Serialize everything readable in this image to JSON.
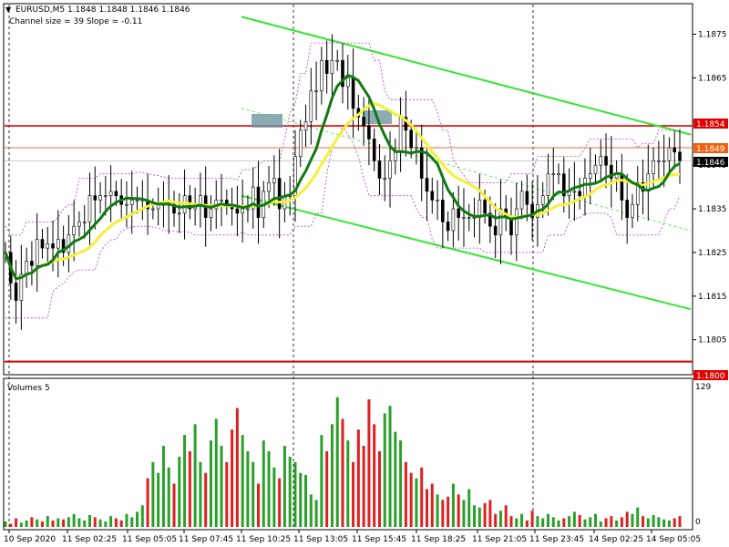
{
  "header": {
    "symbol_line": "EURUSD,M5  1.1848 1.1848 1.1846 1.1846",
    "channel_line": "Channel size = 39 Slope = -0.11"
  },
  "volumes_panel": {
    "label": "Volumes 5",
    "top_value": "129",
    "bottom_value": "0"
  },
  "price_tags": {
    "resistance": "1.1854",
    "current_ref": "1.1849",
    "last": "1.1846",
    "support": "1.1800"
  },
  "colors": {
    "channel": "#32e632",
    "fast_ma": "#117a11",
    "slow_ma": "#f5f03a",
    "envelope": "#b040c0",
    "resistance": "#e00000",
    "current_ref": "#e07040",
    "bull_volume": "#2aa02a",
    "bear_volume": "#e02020",
    "zone_box": "#6f96a0"
  },
  "chart_data": {
    "type": "candlestick",
    "title": "EURUSD,M5",
    "y_ticks": [
      "1.1875",
      "1.1865",
      "1.1855",
      "1.1845",
      "1.1835",
      "1.1825",
      "1.1815",
      "1.1805"
    ],
    "x_ticks": [
      "10 Sep 2020",
      "11 Sep 02:25",
      "11 Sep 05:05",
      "11 Sep 07:45",
      "11 Sep 10:25",
      "11 Sep 13:05",
      "11 Sep 15:45",
      "11 Sep 18:25",
      "11 Sep 21:05",
      "11 Sep 23:45",
      "14 Sep 02:25",
      "14 Sep 05:05"
    ],
    "ylim": [
      1.1797,
      1.1882
    ],
    "volume_ylim": [
      0,
      129
    ],
    "horizontal_levels": [
      1.1854,
      1.1849,
      1.1846,
      1.18
    ],
    "channel": {
      "upper": [
        [
          0,
          1.1879
        ],
        [
          1,
          1.1852
        ]
      ],
      "lower": [
        [
          0,
          1.1838
        ],
        [
          1,
          1.1812
        ]
      ],
      "mid": [
        [
          0,
          1.1858
        ],
        [
          1,
          1.183
        ]
      ]
    },
    "series": [
      {
        "name": "close",
        "values": [
          1.1825,
          1.1818,
          1.1814,
          1.182,
          1.1823,
          1.1822,
          1.1828,
          1.1826,
          1.1827,
          1.1826,
          1.1828,
          1.1825,
          1.1829,
          1.1831,
          1.1832,
          1.1832,
          1.1838,
          1.1837,
          1.1838,
          1.1838,
          1.1839,
          1.1838,
          1.1836,
          1.1836,
          1.1837,
          1.1837,
          1.1837,
          1.1835,
          1.1835,
          1.1836,
          1.1836,
          1.1836,
          1.1834,
          1.1834,
          1.1838,
          1.1835,
          1.1836,
          1.1838,
          1.1833,
          1.1835,
          1.1837,
          1.1837,
          1.1836,
          1.1835,
          1.1834,
          1.1835,
          1.1835,
          1.184,
          1.1833,
          1.1839,
          1.1841,
          1.1842,
          1.1835,
          1.1838,
          1.1838,
          1.1847,
          1.1853,
          1.1855,
          1.1862,
          1.1862,
          1.1869,
          1.1866,
          1.1869,
          1.1869,
          1.1863,
          1.1865,
          1.1858,
          1.1856,
          1.1854,
          1.1851,
          1.1846,
          1.1842,
          1.1842,
          1.1846,
          1.1848,
          1.1856,
          1.1853,
          1.1849,
          1.1849,
          1.1842,
          1.1839,
          1.1837,
          1.1837,
          1.1832,
          1.183,
          1.1835,
          1.1833,
          1.1833,
          1.1833,
          1.1833,
          1.1837,
          1.1834,
          1.1831,
          1.1829,
          1.1835,
          1.1833,
          1.1829,
          1.1835,
          1.1839,
          1.1836,
          1.1833,
          1.1836,
          1.1838,
          1.1843,
          1.1843,
          1.1843,
          1.1838,
          1.1839,
          1.1839,
          1.1838,
          1.1842,
          1.1843,
          1.1845,
          1.1847,
          1.1845,
          1.1842,
          1.1843,
          1.1837,
          1.1833,
          1.1836,
          1.1841,
          1.1839,
          1.1843,
          1.1846,
          1.1846,
          1.1846,
          1.1849,
          1.1848,
          1.1846
        ]
      },
      {
        "name": "volume",
        "values": [
          5,
          3,
          8,
          4,
          6,
          9,
          7,
          5,
          10,
          6,
          8,
          7,
          9,
          12,
          8,
          6,
          11,
          9,
          7,
          5,
          10,
          8,
          6,
          12,
          9,
          14,
          20,
          45,
          60,
          50,
          75,
          55,
          40,
          65,
          85,
          70,
          95,
          60,
          50,
          80,
          100,
          75,
          60,
          90,
          110,
          85,
          70,
          60,
          40,
          80,
          70,
          55,
          45,
          75,
          65,
          60,
          50,
          48,
          30,
          25,
          85,
          70,
          95,
          120,
          100,
          80,
          60,
          90,
          75,
          118,
          95,
          70,
          105,
          112,
          88,
          80,
          60,
          50,
          45,
          55,
          35,
          40,
          30,
          25,
          28,
          40,
          30,
          25,
          35,
          20,
          18,
          22,
          25,
          12,
          15,
          20,
          10,
          8,
          12,
          6,
          15,
          10,
          8,
          12,
          9,
          6,
          8,
          10,
          14,
          11,
          7,
          9,
          12,
          5,
          8,
          10,
          6,
          9,
          14,
          12,
          18,
          10,
          8,
          11,
          9,
          7,
          6,
          8,
          10
        ]
      }
    ]
  }
}
